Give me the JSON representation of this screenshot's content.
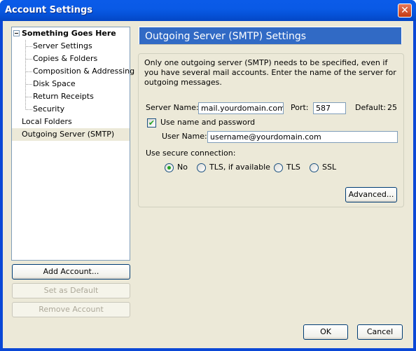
{
  "window": {
    "title": "Account Settings",
    "close_label": "✕"
  },
  "tree": {
    "root": "Something Goes Here",
    "children": [
      "Server Settings",
      "Copies & Folders",
      "Composition & Addressing",
      "Disk Space",
      "Return Receipts",
      "Security"
    ],
    "top_items": [
      "Local Folders",
      "Outgoing Server (SMTP)"
    ],
    "selected": "Outgoing Server (SMTP)"
  },
  "left_buttons": {
    "add_account": "Add Account...",
    "set_default": "Set as Default",
    "remove_account": "Remove Account"
  },
  "panel": {
    "header": "Outgoing Server (SMTP) Settings",
    "description": "Only one outgoing server (SMTP) needs to be specified, even if you have several mail accounts. Enter the name of the server for outgoing messages.",
    "server_name_label": "Server Name:",
    "server_name_value": "mail.yourdomain.com",
    "port_label": "Port:",
    "port_value": "587",
    "default_label": "Default:",
    "default_value": "25",
    "use_auth_label": "Use name and password",
    "use_auth_checked": true,
    "user_name_label": "User Name:",
    "user_name_value": "username@yourdomain.com",
    "secure_label": "Use secure connection:",
    "secure_options": [
      "No",
      "TLS, if available",
      "TLS",
      "SSL"
    ],
    "secure_selected": "No",
    "advanced_button": "Advanced..."
  },
  "footer": {
    "ok": "OK",
    "cancel": "Cancel"
  }
}
